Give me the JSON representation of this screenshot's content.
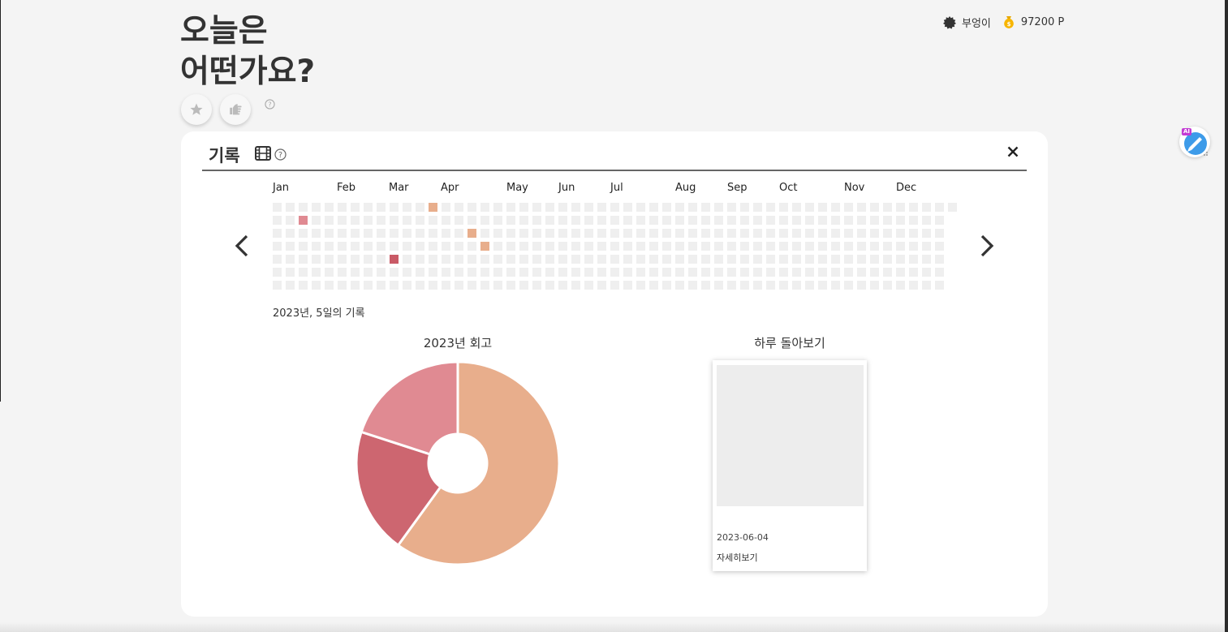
{
  "header": {
    "title_line1": "오늘은",
    "title_line2": "어떤가요?",
    "user_name": "부엉이",
    "points": "97200 P"
  },
  "actions": [
    {
      "icon": "star-icon"
    },
    {
      "icon": "pointing-hand-icon"
    }
  ],
  "record": {
    "title": "기록",
    "months": [
      "Jan",
      "Feb",
      "Mar",
      "Apr",
      "May",
      "Jun",
      "Jul",
      "Aug",
      "Sep",
      "Oct",
      "Nov",
      "Dec"
    ],
    "summary": "2023년, 5일의 기록",
    "colors": {
      "empty": "#efefef",
      "orange": "#e8ae8c",
      "pink": "#e08a92",
      "red": "#c95a66"
    },
    "highlighted_days": [
      {
        "week": 12,
        "day": 0,
        "mood": "orange"
      },
      {
        "week": 2,
        "day": 1,
        "mood": "pink"
      },
      {
        "week": 15,
        "day": 2,
        "mood": "orange"
      },
      {
        "week": 16,
        "day": 3,
        "mood": "orange"
      },
      {
        "week": 9,
        "day": 4,
        "mood": "red"
      }
    ]
  },
  "review": {
    "title": "2023년 회고",
    "chart_data": {
      "type": "pie",
      "values": [
        60,
        20,
        20
      ],
      "colors": [
        "#e8ae8c",
        "#cd6670",
        "#e08a92"
      ],
      "title": "2023년 회고"
    }
  },
  "daily": {
    "title": "하루 돌아보기",
    "date": "2023-06-04",
    "link": "자세히보기"
  },
  "widget": {
    "tag": "AI"
  }
}
